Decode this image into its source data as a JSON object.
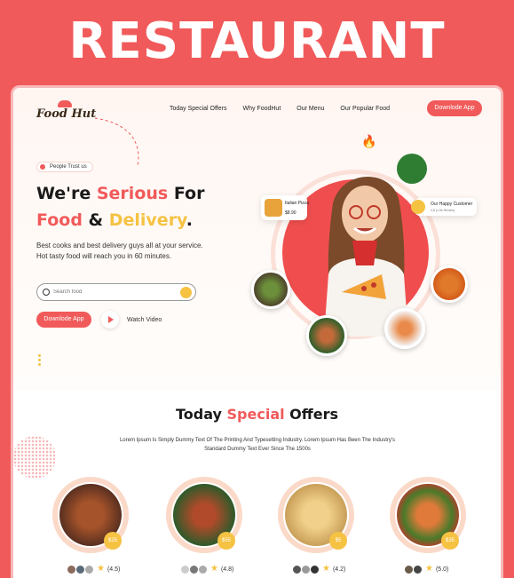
{
  "banner": {
    "title": "RESTAURANT"
  },
  "brand": {
    "logo_text": "Food Hut"
  },
  "nav": {
    "items": [
      "Today Special Offers",
      "Why FoodHut",
      "Our Menu",
      "Our Popular Food"
    ],
    "cta": "Downlode App"
  },
  "hero": {
    "badge": "People Trust us",
    "headline_line1_a": "We're ",
    "headline_line1_b": "Serious",
    "headline_line1_c": " For",
    "headline_line2_a": "Food",
    "headline_line2_b": " & ",
    "headline_line2_c": "Delivery",
    "headline_line2_d": ".",
    "description": "Best cooks and best delivery guys all at your service. Hot tasty food will reach you in 60 minutes.",
    "search_placeholder": "Search food",
    "cta": "Downlode App",
    "watch": "Watch Video",
    "pizza_card": {
      "name": "Italian Pizza",
      "price": "$8.90"
    },
    "customer_card": {
      "title": "Our Happy Customer",
      "rating": "4.8 (1.5k Review)"
    }
  },
  "offers": {
    "title_a": "Today ",
    "title_b": "Special",
    "title_c": " Offers",
    "description": "Lorem Ipsum Is Simply Dummy Text Of The Printing And Typesetting Industry. Lorem Ipsum Has Been The Industry's Standard Dummy Text Ever Since The 1500s",
    "items": [
      {
        "price": "$25",
        "rating": "(4.5)"
      },
      {
        "price": "$55",
        "rating": "(4.8)"
      },
      {
        "price": "$5",
        "rating": "(4.2)"
      },
      {
        "price": "$35",
        "rating": "(5.0)"
      }
    ]
  },
  "colors": {
    "accent": "#f15a5a",
    "yellow": "#f5c242"
  }
}
